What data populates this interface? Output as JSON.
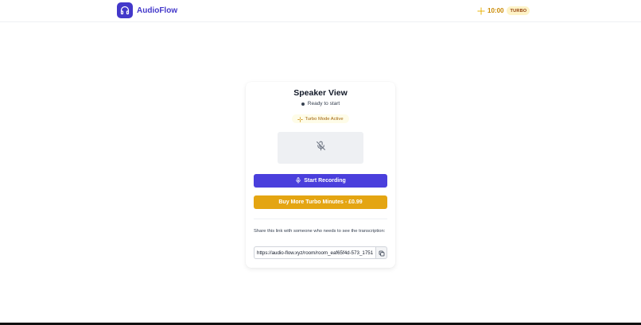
{
  "header": {
    "app_name": "AudioFlow",
    "logo_icon": "headphones-icon",
    "turbo_time": "10:00",
    "turbo_badge": "TURBO",
    "turbo_icon": "sparkle-icon",
    "accent_color": "#4338ca"
  },
  "card": {
    "title": "Speaker View",
    "status": "Ready to start",
    "turbo_label": "Turbo Mode Active",
    "mic_icon": "mic-off-icon",
    "record_label": "Start Recording",
    "buy_label": "Buy More Turbo Minutes - £0.99",
    "share_text": "Share this link with someone who needs to see the transcription:",
    "share_link": "https://audio-flow.xyz/room/room_eaf65f4d-573_1751",
    "record_color": "#4a3fdc",
    "buy_color": "#e4a512"
  }
}
